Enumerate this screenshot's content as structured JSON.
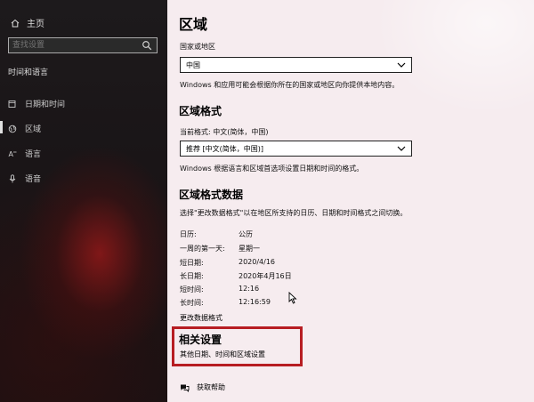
{
  "sidebar": {
    "home_label": "主页",
    "search_placeholder": "查找设置",
    "section_title": "时间和语言",
    "items": [
      {
        "label": "日期和时间",
        "icon": "calendar-clock-icon"
      },
      {
        "label": "区域",
        "icon": "globe-icon",
        "active": true
      },
      {
        "label": "语言",
        "icon": "language-icon"
      },
      {
        "label": "语音",
        "icon": "microphone-icon"
      }
    ]
  },
  "main": {
    "title": "区域",
    "country_label": "国家或地区",
    "country_value": "中国",
    "country_desc": "Windows 和应用可能会根据你所在的国家或地区向你提供本地内容。",
    "format_title": "区域格式",
    "current_format": "当前格式: 中文(简体，中国)",
    "format_value": "推荐 [中文(简体，中国)]",
    "format_desc": "Windows 根据语言和区域首选项设置日期和时间的格式。",
    "format_data_title": "区域格式数据",
    "format_data_desc": "选择\"更改数据格式\"以在地区所支持的日历、日期和时间格式之间切换。",
    "rows": [
      {
        "label": "日历:",
        "value": "公历"
      },
      {
        "label": "一周的第一天:",
        "value": "星期一"
      },
      {
        "label": "短日期:",
        "value": "2020/4/16"
      },
      {
        "label": "长日期:",
        "value": "2020年4月16日"
      },
      {
        "label": "短时间:",
        "value": "12:16"
      },
      {
        "label": "长时间:",
        "value": "12:16:59"
      }
    ],
    "change_link": "更改数据格式",
    "related_title": "相关设置",
    "related_link": "其他日期、时间和区域设置",
    "help_link": "获取帮助"
  },
  "colors": {
    "highlight": "#b71d22",
    "content_bg": "#f6ecef"
  }
}
